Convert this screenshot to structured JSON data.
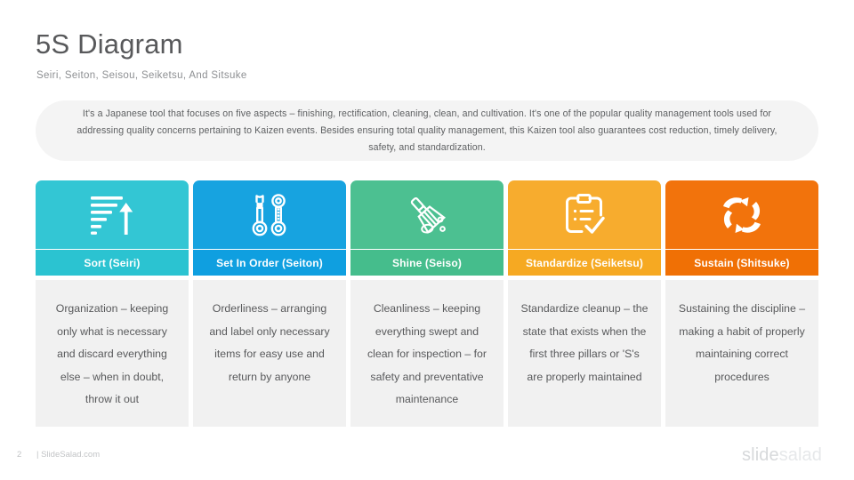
{
  "header": {
    "title": "5S Diagram",
    "subtitle": "Seiri, Seiton, Seisou, Seiketsu, And Sitsuke"
  },
  "description": "It's a Japanese tool that focuses on five aspects – finishing, rectification, cleaning, clean, and cultivation. It's one of the popular quality management tools used for addressing quality concerns pertaining to Kaizen events. Besides ensuring total quality management, this Kaizen tool also guarantees cost reduction, timely delivery, safety, and standardization.",
  "cards": [
    {
      "label": "Sort (Seiri)",
      "icon": "sort-bars-arrow-icon",
      "icon_color": "#33c6d4",
      "label_color": "#2bc3d1",
      "body": "Organization – keeping only what is necessary and discard everything else – when in doubt, throw it out"
    },
    {
      "label": "Set In Order (Seiton)",
      "icon": "wrenches-icon",
      "icon_color": "#17a3e0",
      "label_color": "#0f9fe0",
      "body": "Orderliness – arranging and label only necessary items for easy use and return by anyone"
    },
    {
      "label": "Shine (Seiso)",
      "icon": "broom-icon",
      "icon_color": "#4cc091",
      "label_color": "#45bd8c",
      "body": "Cleanliness – keeping everything swept and clean for inspection – for safety and preventative maintenance"
    },
    {
      "label": "Standardize (Seiketsu)",
      "icon": "clipboard-check-icon",
      "icon_color": "#f7ac2e",
      "label_color": "#f6a922",
      "body": "Standardize cleanup – the state that exists when the first three pillars or 'S's are properly maintained"
    },
    {
      "label": "Sustain (Shitsuke)",
      "icon": "refresh-cycle-icon",
      "icon_color": "#f2730c",
      "label_color": "#f07005",
      "body": "Sustaining the discipline – making a habit of properly maintaining correct procedures"
    }
  ],
  "footer": {
    "page_number": "2",
    "site": "| SlideSalad.com",
    "logo_first": "slide",
    "logo_second": "salad"
  }
}
